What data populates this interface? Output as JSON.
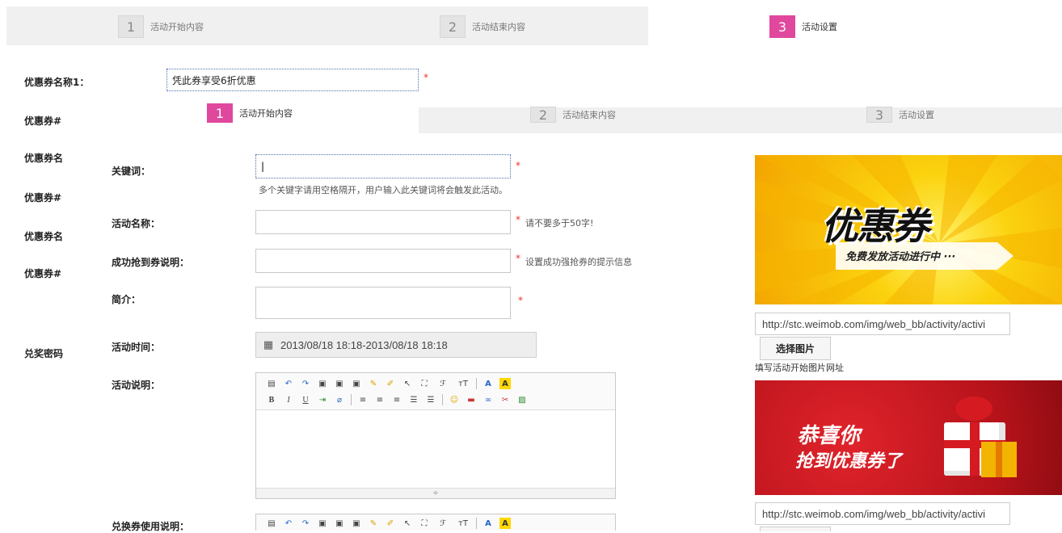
{
  "steps_back": [
    {
      "num": "1",
      "label": "活动开始内容"
    },
    {
      "num": "2",
      "label": "活动结束内容"
    },
    {
      "num": "3",
      "label": "活动设置"
    }
  ],
  "steps_front": [
    {
      "num": "1",
      "label": "活动开始内容"
    },
    {
      "num": "2",
      "label": "活动结束内容"
    },
    {
      "num": "3",
      "label": "活动设置"
    }
  ],
  "back_form": {
    "coupon_name_label": "优惠券名称1：",
    "coupon_name_value": "凭此券享受6折优惠",
    "required": "*",
    "row_labels": [
      "优惠券#",
      "优惠券名",
      "优惠券#",
      "优惠券名",
      "优惠券#"
    ],
    "redeem_label": "兑奖密码"
  },
  "form": {
    "keyword_label": "关键词：",
    "keyword_value": "|",
    "keyword_hint": "多个关键字请用空格隔开，用户输入此关键词将会触发此活动。",
    "name_label": "活动名称：",
    "name_hint": "请不要多于50字!",
    "success_label": "成功抢到券说明：",
    "success_hint": "设置成功强抢券的提示信息",
    "intro_label": "简介：",
    "time_label": "活动时间：",
    "time_value": "2013/08/18 18:18-2013/08/18 18:18",
    "desc_label": "活动说明：",
    "redeem_desc_label": "兑换券使用说明：",
    "required": "*"
  },
  "right": {
    "banner1_title": "优惠券",
    "banner1_sub": "免费发放活动进行中 ···",
    "url1": "http://stc.weimob.com/img/web_bb/activity/activi",
    "select_button": "选择图片",
    "url_hint": "填写活动开始图片网址",
    "banner2_line1": "恭喜你",
    "banner2_line2": "抢到优惠券了",
    "url2": "http://stc.weimob.com/img/web_bb/activity/activi"
  },
  "toolbar": {
    "row1": [
      "source-icon",
      "undo-icon",
      "redo-icon",
      "paste-icon",
      "paste-text-icon",
      "paste-word-icon",
      "clear-format-icon",
      "format-brush-icon",
      "select-icon",
      "fullscreen-icon",
      "font-family-icon",
      "font-size-icon",
      "font-color-icon",
      "highlight-icon"
    ],
    "row2": [
      "bold-icon",
      "italic-icon",
      "underline-icon",
      "strikethrough-icon",
      "eraser-icon",
      "align-left-icon",
      "align-center-icon",
      "align-right-icon",
      "ordered-list-icon",
      "unordered-list-icon",
      "emoticon-icon",
      "image-icon",
      "link-icon",
      "unlink-icon",
      "picture-icon"
    ],
    "font_family_glyph": "ℱ",
    "font_size_glyph": "тT",
    "font_color_glyph": "A",
    "bold_glyph": "B",
    "italic_glyph": "I",
    "underline_glyph": "U"
  },
  "colors": {
    "accent": "#e0489e",
    "required": "#ee3333",
    "banner1_bg": "#f8c20a",
    "banner2_bg": "#c8161e"
  }
}
